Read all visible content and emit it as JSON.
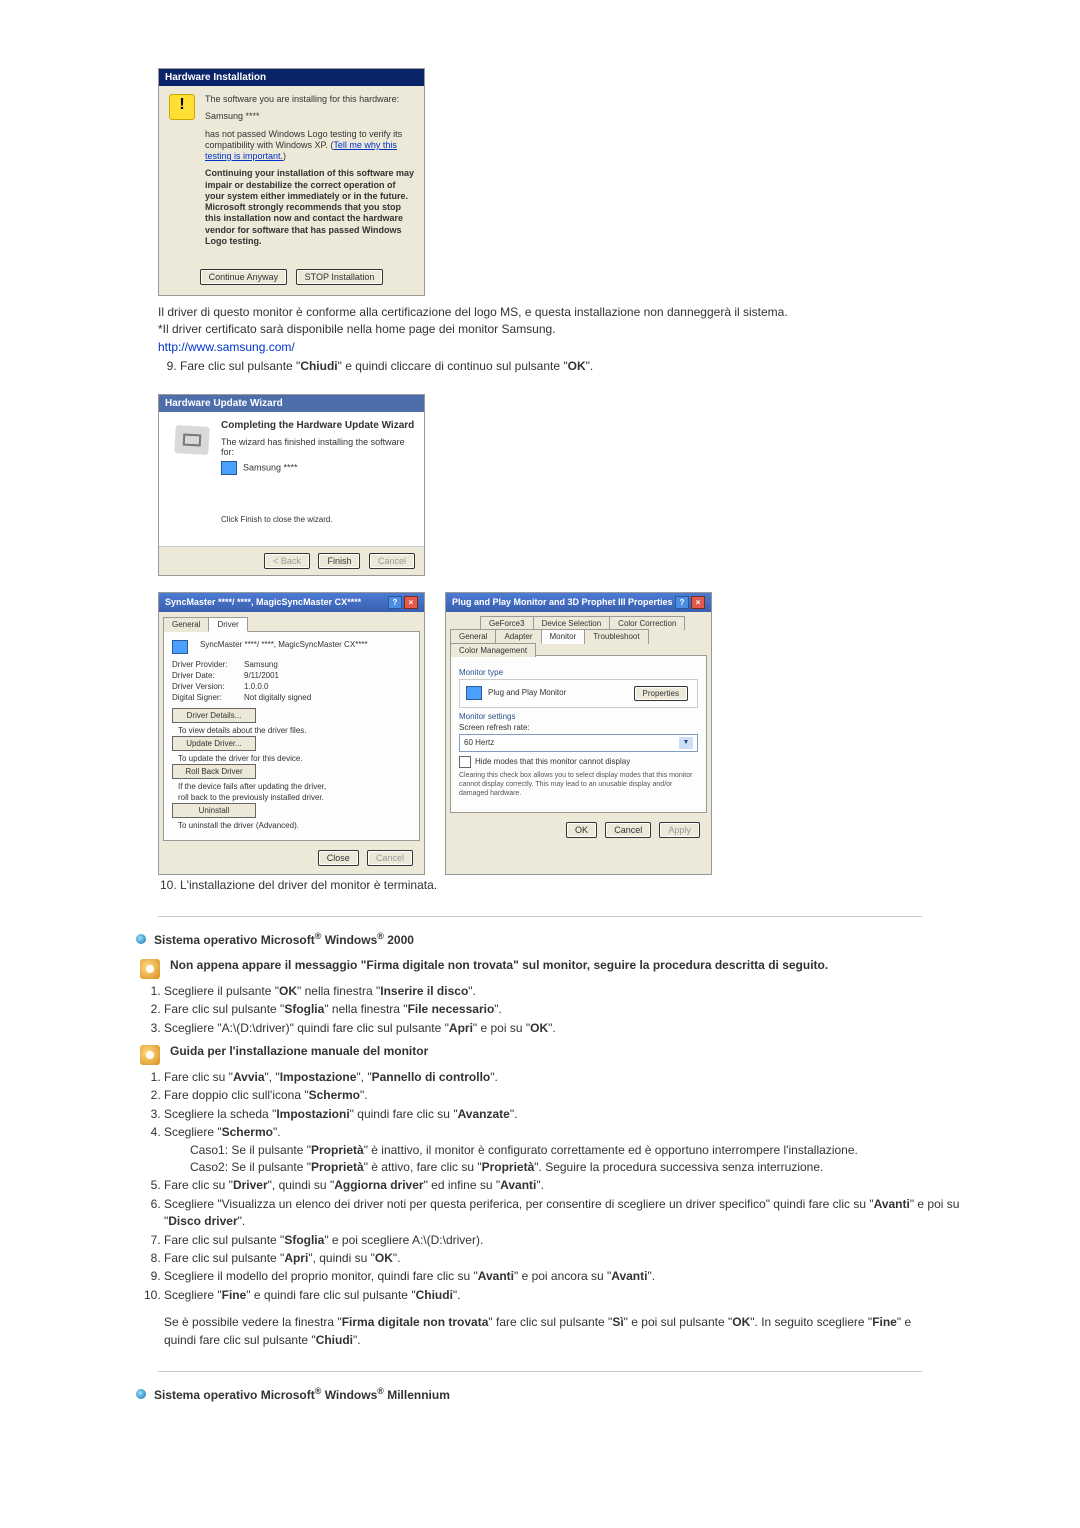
{
  "dialog_hw": {
    "title": "Hardware Installation",
    "line1": "The software you are installing for this hardware:",
    "device": "Samsung ****",
    "line2a": "has not passed Windows Logo testing to verify its compatibility with Windows XP. (",
    "tell_link": "Tell me why this testing is important.",
    "line2b": ")",
    "warning": "Continuing your installation of this software may impair or destabilize the correct operation of your system either immediately or in the future. Microsoft strongly recommends that you stop this installation now and contact the hardware vendor for software that has passed Windows Logo testing.",
    "btn_continue": "Continue Anyway",
    "btn_stop": "STOP Installation"
  },
  "body1": {
    "p1": "Il driver di questo monitor è conforme alla certificazione del logo MS, e questa installazione non danneggerà il sistema.",
    "p2": "*Il driver certificato sarà disponibile nella home page dei monitor Samsung.",
    "link": "http://www.samsung.com/"
  },
  "step9_pre": "Fare clic sul pulsante \"",
  "step9_b1": "Chiudi",
  "step9_mid": "\" e quindi cliccare di continuo sul pulsante \"",
  "step9_b2": "OK",
  "step9_post": "\".",
  "wizard": {
    "title": "Hardware Update Wizard",
    "heading": "Completing the Hardware Update Wizard",
    "line1": "The wizard has finished installing the software for:",
    "device": "Samsung ****",
    "hint": "Click Finish to close the wizard.",
    "back": "< Back",
    "finish": "Finish",
    "cancel": "Cancel"
  },
  "props_driver": {
    "title": "SyncMaster ****/ ****, MagicSyncMaster CX****",
    "tab_general": "General",
    "tab_driver": "Driver",
    "device_name": "SyncMaster ****/ ****, MagicSyncMaster CX****",
    "provider_lbl": "Driver Provider:",
    "provider": "Samsung",
    "date_lbl": "Driver Date:",
    "date": "9/11/2001",
    "version_lbl": "Driver Version:",
    "version": "1.0.0.0",
    "signer_lbl": "Digital Signer:",
    "signer": "Not digitally signed",
    "btn_details": "Driver Details...",
    "btn_details_desc": "To view details about the driver files.",
    "btn_update": "Update Driver...",
    "btn_update_desc": "To update the driver for this device.",
    "btn_rollback": "Roll Back Driver",
    "btn_rollback_desc": "If the device fails after updating the driver, roll back to the previously installed driver.",
    "btn_uninstall": "Uninstall",
    "btn_uninstall_desc": "To uninstall the driver (Advanced).",
    "close": "Close",
    "cancel": "Cancel"
  },
  "props_monitor": {
    "title": "Plug and Play Monitor and 3D Prophet III Properties",
    "tabs_top": [
      "GeForce3",
      "Device Selection",
      "Color Correction"
    ],
    "tabs_bottom": [
      "General",
      "Adapter",
      "Monitor",
      "Troubleshoot",
      "Color Management"
    ],
    "mon_type_lbl": "Monitor type",
    "mon_name": "Plug and Play Monitor",
    "prop_btn": "Properties",
    "settings_lbl": "Monitor settings",
    "refresh_lbl": "Screen refresh rate:",
    "refresh_val": "60 Hertz",
    "hide_chk": "Hide modes that this monitor cannot display",
    "hide_note": "Clearing this check box allows you to select display modes that this monitor cannot display correctly. This may lead to an unusable display and/or damaged hardware.",
    "ok": "OK",
    "cancel": "Cancel",
    "apply": "Apply"
  },
  "step10": "L'installazione del driver del monitor è terminata.",
  "os2000": {
    "title_pre": "Sistema operativo Microsoft",
    "title_mid": " Windows",
    "title_post": " 2000",
    "note": "Non appena appare il messaggio \"Firma digitale non trovata\" sul monitor, seguire la procedura descritta di seguito.",
    "s1": [
      "Scegliere il pulsante \"",
      "OK",
      "\" nella finestra \"",
      "Inserire il disco",
      "\"."
    ],
    "s2": [
      "Fare clic sul pulsante \"",
      "Sfoglia",
      "\" nella finestra \"",
      "File necessario",
      "\"."
    ],
    "s3": [
      "Scegliere \"A:\\(D:\\driver)\" quindi fare clic sul pulsante \"",
      "Apri",
      "\" e poi su \"",
      "OK",
      "\"."
    ],
    "guide": "Guida per l'installazione manuale del monitor",
    "m1": [
      "Fare clic su \"",
      "Avvia",
      "\", \"",
      "Impostazione",
      "\", \"",
      "Pannello di controllo",
      "\"."
    ],
    "m2": [
      "Fare doppio clic sull'icona \"",
      "Schermo",
      "\"."
    ],
    "m3": [
      "Scegliere la scheda \"",
      "Impostazioni",
      "\" quindi fare clic su \"",
      "Avanzate",
      "\"."
    ],
    "m4": [
      "Scegliere \"",
      "Schermo",
      "\"."
    ],
    "m4_c1": [
      "Caso1: Se il pulsante \"",
      "Proprietà",
      "\" è inattivo, il monitor è configurato correttamente ed è opportuno interrompere l'installazione."
    ],
    "m4_c2": [
      "Caso2: Se il pulsante \"",
      "Proprietà",
      "\" è attivo, fare clic su \"",
      "Proprietà",
      "\". Seguire la procedura successiva senza interruzione."
    ],
    "m5": [
      "Fare clic su \"",
      "Driver",
      "\", quindi su \"",
      "Aggiorna driver",
      "\" ed infine su \"",
      "Avanti",
      "\"."
    ],
    "m6": "Scegliere \"Visualizza un elenco dei driver noti per questa periferica, per consentire di scegliere un driver specifico\" quindi fare clic su \"",
    "m6_b1": "Avanti",
    "m6_mid": "\" e poi su \"",
    "m6_b2": "Disco driver",
    "m6_post": "\".",
    "m7": [
      "Fare clic sul pulsante \"",
      "Sfoglia",
      "\" e poi scegliere A:\\(D:\\driver)."
    ],
    "m8": [
      "Fare clic sul pulsante \"",
      "Apri",
      "\", quindi su \"",
      "OK",
      "\"."
    ],
    "m9": [
      "Scegliere il modello del proprio monitor, quindi fare clic su \"",
      "Avanti",
      "\" e poi ancora su \"",
      "Avanti",
      "\"."
    ],
    "m10": [
      "Scegliere \"",
      "Fine",
      "\" e quindi fare clic sul pulsante \"",
      "Chiudi",
      "\"."
    ],
    "after": [
      "Se è possibile vedere la finestra \"",
      "Firma digitale non trovata",
      "\" fare clic sul pulsante \"",
      "Sì",
      "\" e poi sul pulsante \"",
      "OK",
      "\". In seguito scegliere \"",
      "Fine",
      "\" e quindi fare clic sul pulsante \"",
      "Chiudi",
      "\"."
    ]
  },
  "osME": {
    "title_pre": "Sistema operativo Microsoft",
    "title_mid": " Windows",
    "title_post": " Millennium"
  }
}
